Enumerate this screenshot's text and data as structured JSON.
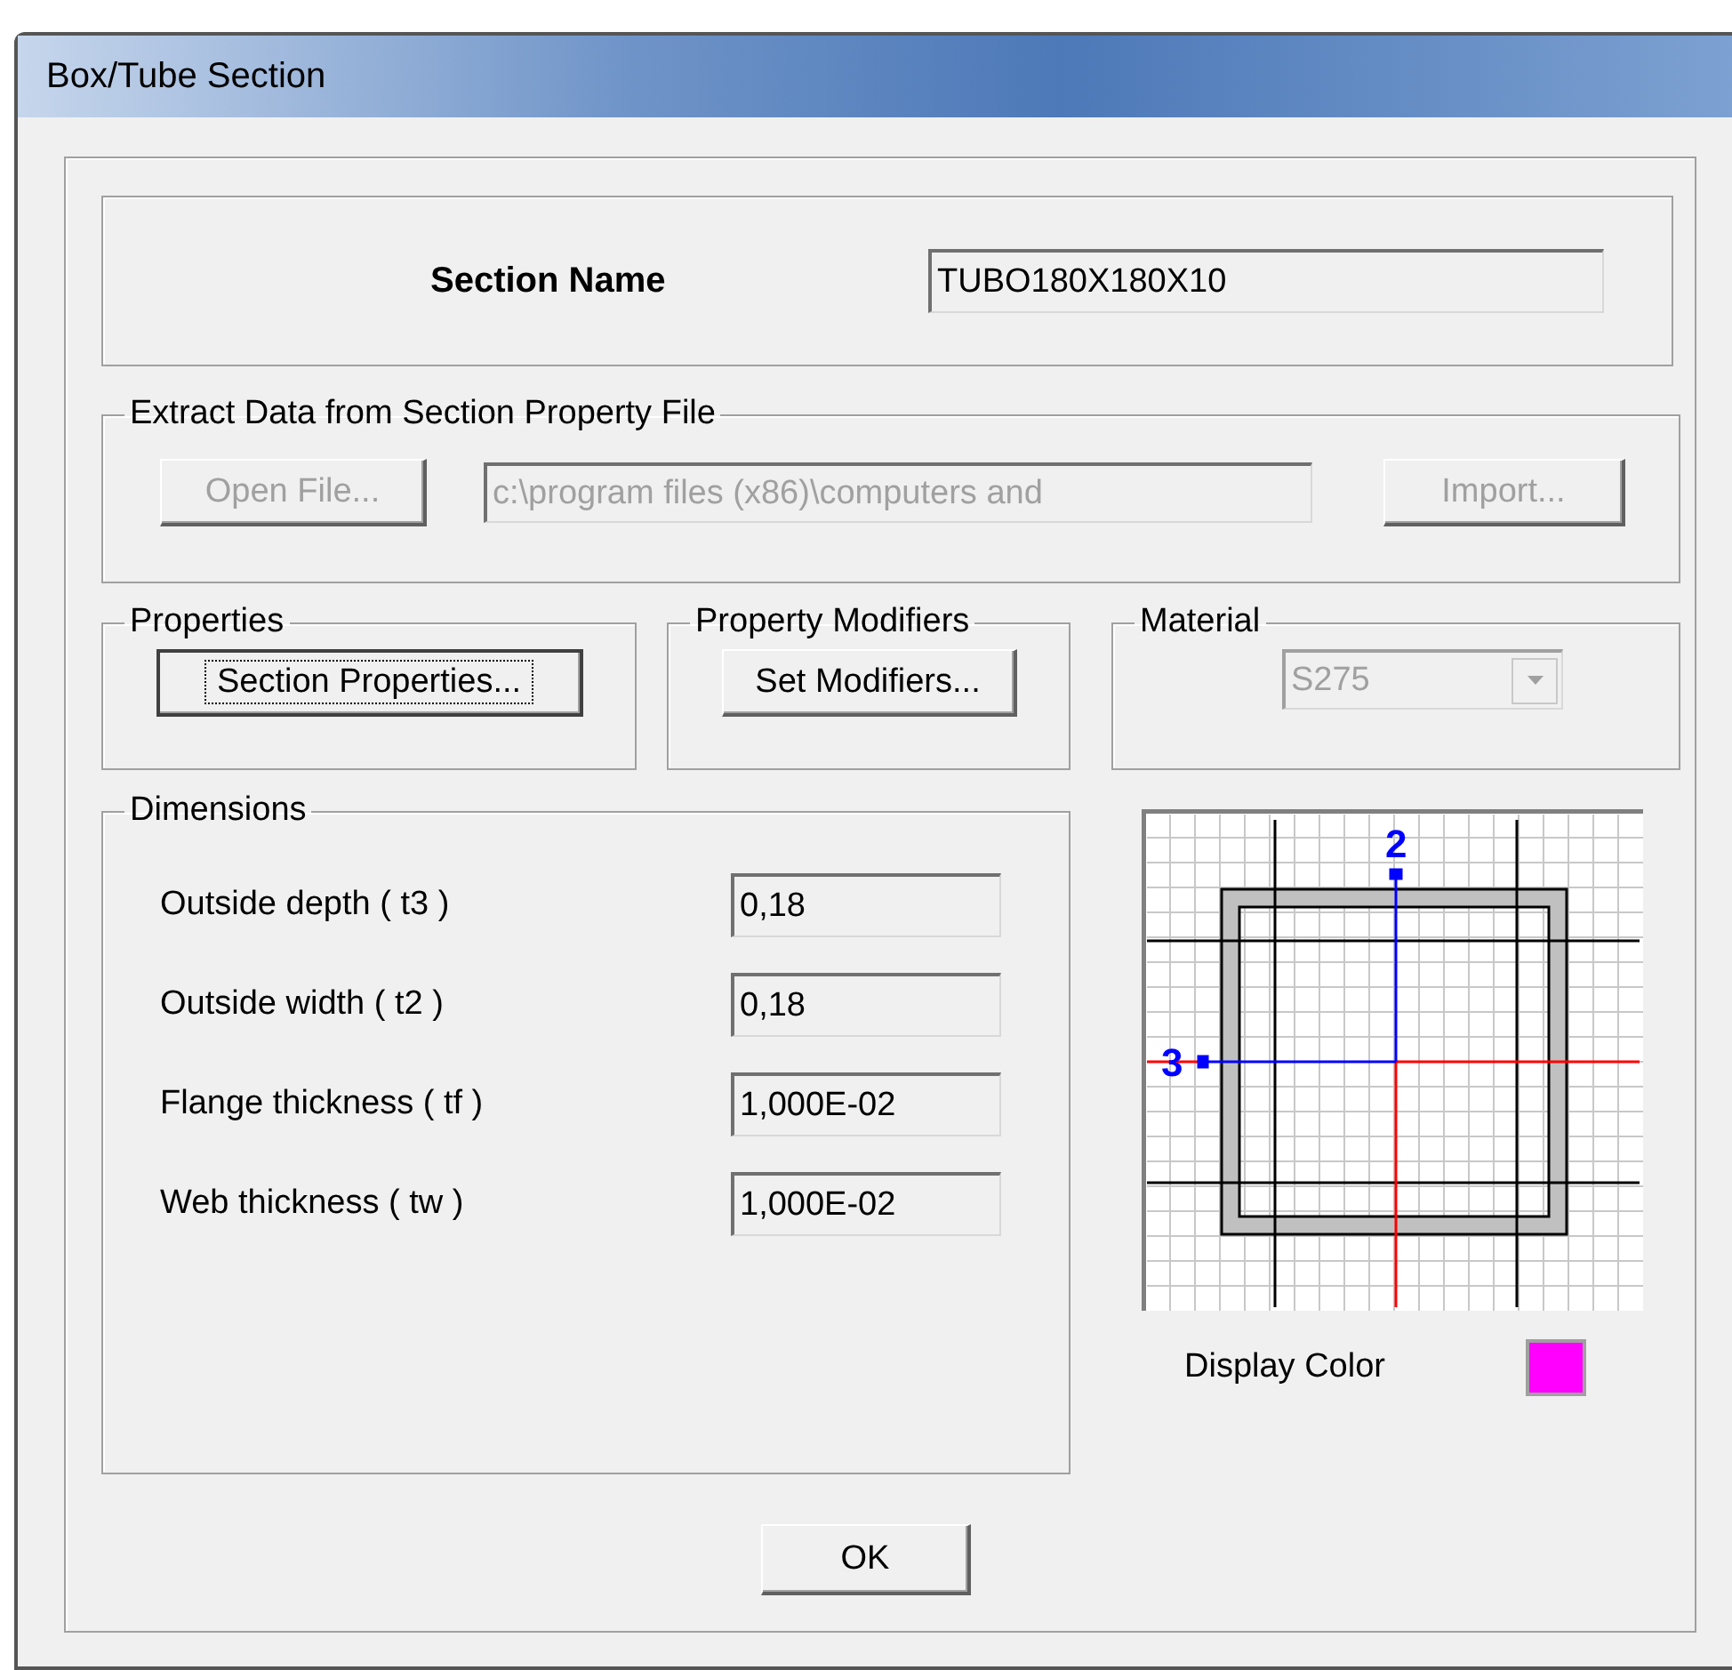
{
  "window": {
    "title": "Box/Tube Section"
  },
  "section_name": {
    "label": "Section Name",
    "value": "TUBO180X180X10"
  },
  "extract": {
    "title": "Extract Data from Section Property File",
    "open_button": {
      "label": "Open File...",
      "disabled": true
    },
    "path": {
      "value": "c:\\program files (x86)\\computers and",
      "disabled": true
    },
    "import_button": {
      "label": "Import...",
      "disabled": true
    }
  },
  "properties": {
    "title": "Properties",
    "button": {
      "label": "Section Properties...",
      "focused": true
    }
  },
  "property_modifiers": {
    "title": "Property Modifiers",
    "button": {
      "label": "Set Modifiers...",
      "focused": false
    }
  },
  "material": {
    "title": "Material",
    "value": "S275",
    "disabled": true
  },
  "dimensions": {
    "title": "Dimensions",
    "fields": [
      {
        "label": "Outside depth  ( t3 )",
        "value": "0,18"
      },
      {
        "label": "Outside width  ( t2 )",
        "value": "0,18"
      },
      {
        "label": "Flange thickness  ( tf )",
        "value": "1,000E-02"
      },
      {
        "label": "Web thickness  ( tw )",
        "value": "1,000E-02"
      }
    ]
  },
  "diagram": {
    "axis_2": "2",
    "axis_3": "3"
  },
  "display_color": {
    "label": "Display Color",
    "color": "#ff00ff"
  },
  "buttons": [
    {
      "label": "OK"
    }
  ]
}
